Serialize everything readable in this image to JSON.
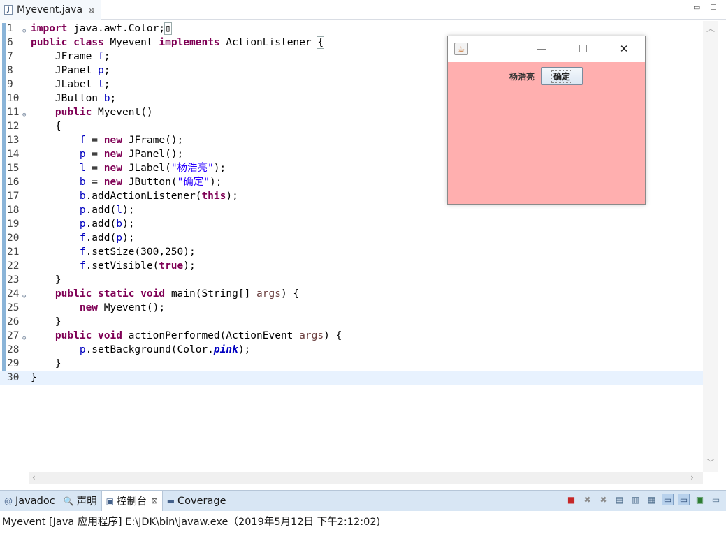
{
  "editor_tab": {
    "icon": "J",
    "label": "Myevent.java",
    "close": "⊠"
  },
  "window_controls": {
    "minimize": "▭",
    "maximize": "☐"
  },
  "code_lines": [
    {
      "num": "1",
      "fold": "⊕",
      "tokens": [
        {
          "t": "import",
          "c": "kw"
        },
        {
          "t": " java.awt.Color;",
          "c": ""
        },
        {
          "t": "▯",
          "c": "box"
        }
      ]
    },
    {
      "num": "6",
      "fold": "",
      "tokens": [
        {
          "t": "public",
          "c": "kw"
        },
        {
          "t": " ",
          "c": ""
        },
        {
          "t": "class",
          "c": "kw"
        },
        {
          "t": " Myevent ",
          "c": ""
        },
        {
          "t": "implements",
          "c": "kw"
        },
        {
          "t": " ActionListener ",
          "c": ""
        },
        {
          "t": "{",
          "c": "box"
        }
      ]
    },
    {
      "num": "7",
      "fold": "",
      "tokens": [
        {
          "t": "    JFrame ",
          "c": ""
        },
        {
          "t": "f",
          "c": "fld"
        },
        {
          "t": ";",
          "c": ""
        }
      ]
    },
    {
      "num": "8",
      "fold": "",
      "tokens": [
        {
          "t": "    JPanel ",
          "c": ""
        },
        {
          "t": "p",
          "c": "fld"
        },
        {
          "t": ";",
          "c": ""
        }
      ]
    },
    {
      "num": "9",
      "fold": "",
      "tokens": [
        {
          "t": "    JLabel ",
          "c": ""
        },
        {
          "t": "l",
          "c": "fld"
        },
        {
          "t": ";",
          "c": ""
        }
      ]
    },
    {
      "num": "10",
      "fold": "",
      "tokens": [
        {
          "t": "    JButton ",
          "c": ""
        },
        {
          "t": "b",
          "c": "fld"
        },
        {
          "t": ";",
          "c": ""
        }
      ]
    },
    {
      "num": "11",
      "fold": "⊖",
      "tokens": [
        {
          "t": "    ",
          "c": ""
        },
        {
          "t": "public",
          "c": "kw"
        },
        {
          "t": " Myevent()",
          "c": ""
        }
      ]
    },
    {
      "num": "12",
      "fold": "",
      "tokens": [
        {
          "t": "    {",
          "c": ""
        }
      ]
    },
    {
      "num": "13",
      "fold": "",
      "tokens": [
        {
          "t": "        ",
          "c": ""
        },
        {
          "t": "f",
          "c": "fld"
        },
        {
          "t": " = ",
          "c": ""
        },
        {
          "t": "new",
          "c": "kw"
        },
        {
          "t": " JFrame();",
          "c": ""
        }
      ]
    },
    {
      "num": "14",
      "fold": "",
      "tokens": [
        {
          "t": "        ",
          "c": ""
        },
        {
          "t": "p",
          "c": "fld"
        },
        {
          "t": " = ",
          "c": ""
        },
        {
          "t": "new",
          "c": "kw"
        },
        {
          "t": " JPanel();",
          "c": ""
        }
      ]
    },
    {
      "num": "15",
      "fold": "",
      "tokens": [
        {
          "t": "        ",
          "c": ""
        },
        {
          "t": "l",
          "c": "fld"
        },
        {
          "t": " = ",
          "c": ""
        },
        {
          "t": "new",
          "c": "kw"
        },
        {
          "t": " JLabel(",
          "c": ""
        },
        {
          "t": "\"杨浩亮\"",
          "c": "str"
        },
        {
          "t": ");",
          "c": ""
        }
      ]
    },
    {
      "num": "16",
      "fold": "",
      "tokens": [
        {
          "t": "        ",
          "c": ""
        },
        {
          "t": "b",
          "c": "fld"
        },
        {
          "t": " = ",
          "c": ""
        },
        {
          "t": "new",
          "c": "kw"
        },
        {
          "t": " JButton(",
          "c": ""
        },
        {
          "t": "\"确定\"",
          "c": "str"
        },
        {
          "t": ");",
          "c": ""
        }
      ]
    },
    {
      "num": "17",
      "fold": "",
      "tokens": [
        {
          "t": "        ",
          "c": ""
        },
        {
          "t": "b",
          "c": "fld"
        },
        {
          "t": ".addActionListener(",
          "c": ""
        },
        {
          "t": "this",
          "c": "kw"
        },
        {
          "t": ");",
          "c": ""
        }
      ]
    },
    {
      "num": "18",
      "fold": "",
      "tokens": [
        {
          "t": "        ",
          "c": ""
        },
        {
          "t": "p",
          "c": "fld"
        },
        {
          "t": ".add(",
          "c": ""
        },
        {
          "t": "l",
          "c": "fld"
        },
        {
          "t": ");",
          "c": ""
        }
      ]
    },
    {
      "num": "19",
      "fold": "",
      "tokens": [
        {
          "t": "        ",
          "c": ""
        },
        {
          "t": "p",
          "c": "fld"
        },
        {
          "t": ".add(",
          "c": ""
        },
        {
          "t": "b",
          "c": "fld"
        },
        {
          "t": ");",
          "c": ""
        }
      ]
    },
    {
      "num": "20",
      "fold": "",
      "tokens": [
        {
          "t": "        ",
          "c": ""
        },
        {
          "t": "f",
          "c": "fld"
        },
        {
          "t": ".add(",
          "c": ""
        },
        {
          "t": "p",
          "c": "fld"
        },
        {
          "t": ");",
          "c": ""
        }
      ]
    },
    {
      "num": "21",
      "fold": "",
      "tokens": [
        {
          "t": "        ",
          "c": ""
        },
        {
          "t": "f",
          "c": "fld"
        },
        {
          "t": ".setSize(300,250);",
          "c": ""
        }
      ]
    },
    {
      "num": "22",
      "fold": "",
      "tokens": [
        {
          "t": "        ",
          "c": ""
        },
        {
          "t": "f",
          "c": "fld"
        },
        {
          "t": ".setVisible(",
          "c": ""
        },
        {
          "t": "true",
          "c": "kw"
        },
        {
          "t": ");",
          "c": ""
        }
      ]
    },
    {
      "num": "23",
      "fold": "",
      "tokens": [
        {
          "t": "    }",
          "c": ""
        }
      ]
    },
    {
      "num": "24",
      "fold": "⊖",
      "tokens": [
        {
          "t": "    ",
          "c": ""
        },
        {
          "t": "public",
          "c": "kw"
        },
        {
          "t": " ",
          "c": ""
        },
        {
          "t": "static",
          "c": "kw"
        },
        {
          "t": " ",
          "c": ""
        },
        {
          "t": "void",
          "c": "kw"
        },
        {
          "t": " main(String[] ",
          "c": ""
        },
        {
          "t": "args",
          "c": "prm"
        },
        {
          "t": ") {",
          "c": ""
        }
      ]
    },
    {
      "num": "25",
      "fold": "",
      "tokens": [
        {
          "t": "        ",
          "c": ""
        },
        {
          "t": "new",
          "c": "kw"
        },
        {
          "t": " Myevent();",
          "c": ""
        }
      ]
    },
    {
      "num": "26",
      "fold": "",
      "tokens": [
        {
          "t": "    }",
          "c": ""
        }
      ]
    },
    {
      "num": "27",
      "fold": "⊖",
      "tokens": [
        {
          "t": "    ",
          "c": ""
        },
        {
          "t": "public",
          "c": "kw"
        },
        {
          "t": " ",
          "c": ""
        },
        {
          "t": "void",
          "c": "kw"
        },
        {
          "t": " actionPerformed(ActionEvent ",
          "c": ""
        },
        {
          "t": "args",
          "c": "prm"
        },
        {
          "t": ") {",
          "c": ""
        }
      ]
    },
    {
      "num": "28",
      "fold": "",
      "tokens": [
        {
          "t": "        ",
          "c": ""
        },
        {
          "t": "p",
          "c": "fld"
        },
        {
          "t": ".setBackground(Color.",
          "c": ""
        },
        {
          "t": "pink",
          "c": "sfld"
        },
        {
          "t": ");",
          "c": ""
        }
      ]
    },
    {
      "num": "29",
      "fold": "",
      "tokens": [
        {
          "t": "    }",
          "c": ""
        }
      ]
    },
    {
      "num": "30",
      "fold": "",
      "current": true,
      "tokens": [
        {
          "t": "}",
          "c": ""
        }
      ]
    }
  ],
  "java_frame": {
    "label": "杨浩亮",
    "button": "确定",
    "panel_color": "#ffafaf",
    "controls": {
      "minimize": "—",
      "maximize": "☐",
      "close": "✕"
    }
  },
  "console_tabs": [
    {
      "icon": "@",
      "label": "Javadoc",
      "active": false
    },
    {
      "icon": "🔍",
      "label": "声明",
      "active": false
    },
    {
      "icon": "▣",
      "label": "控制台",
      "active": true,
      "close": "⊠"
    },
    {
      "icon": "▬",
      "label": "Coverage",
      "active": false
    }
  ],
  "console_status": "Myevent [Java 应用程序] E:\\JDK\\bin\\javaw.exe（2019年5月12日 下午2:12:02)",
  "colors": {
    "keyword": "#7f0055",
    "string": "#2a00ff",
    "field": "#0000c0",
    "current_line": "#e8f2fe"
  }
}
